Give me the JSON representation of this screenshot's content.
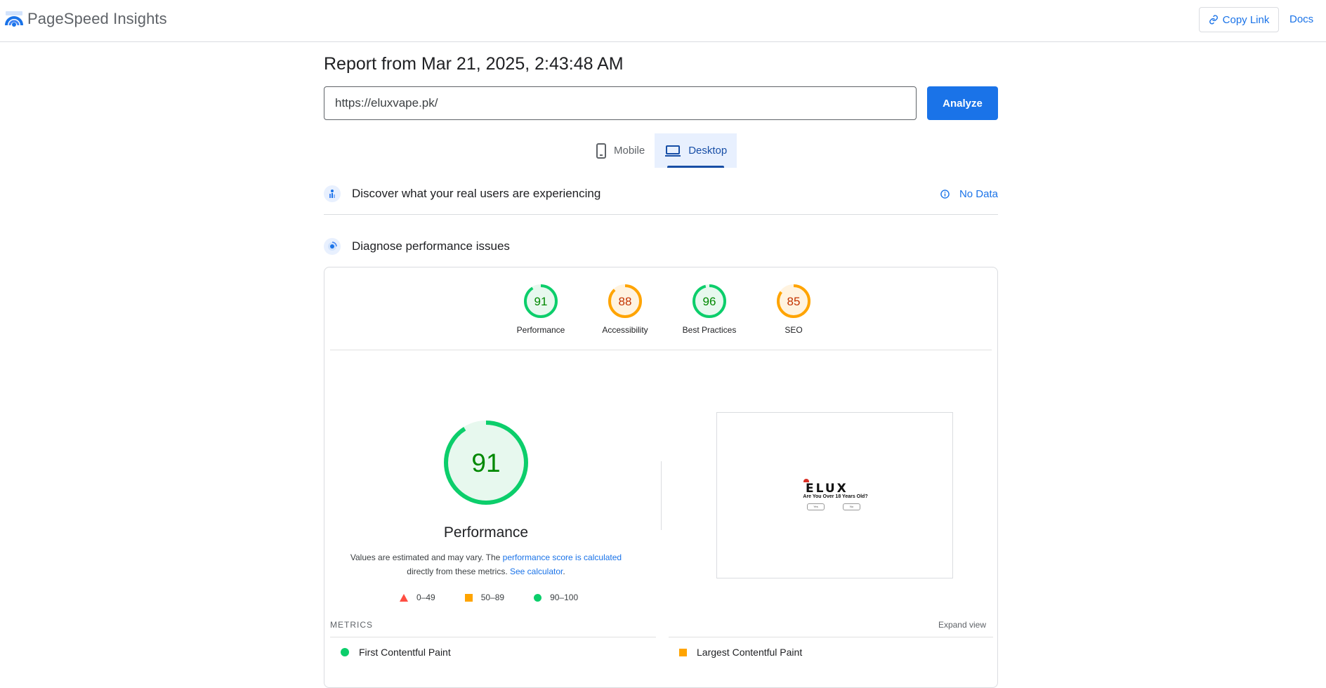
{
  "header": {
    "app_name": "PageSpeed Insights",
    "copy_link_label": "Copy Link",
    "docs_label": "Docs"
  },
  "report": {
    "title": "Report from Mar 21, 2025, 2:43:48 AM",
    "url_value": "https://eluxvape.pk/",
    "analyze_label": "Analyze"
  },
  "device_tabs": [
    {
      "label": "Mobile",
      "active": false
    },
    {
      "label": "Desktop",
      "active": true
    }
  ],
  "field_data": {
    "title": "Discover what your real users are experiencing",
    "status": "No Data"
  },
  "diagnose": {
    "title": "Diagnose performance issues"
  },
  "scores": [
    {
      "label": "Performance",
      "score": 91,
      "color": "#0cce6b",
      "text_color": "#008800",
      "bg": "#e7f8ee"
    },
    {
      "label": "Accessibility",
      "score": 88,
      "color": "#ffa400",
      "text_color": "#c33300",
      "bg": "#fff3e0"
    },
    {
      "label": "Best Practices",
      "score": 96,
      "color": "#0cce6b",
      "text_color": "#008800",
      "bg": "#e7f8ee"
    },
    {
      "label": "SEO",
      "score": 85,
      "color": "#ffa400",
      "text_color": "#c33300",
      "bg": "#fff3e0"
    }
  ],
  "performance": {
    "score": 91,
    "title": "Performance",
    "note_prefix": "Values are estimated and may vary. The ",
    "note_link1": "performance score is calculated",
    "note_middle": "directly from these metrics. ",
    "note_link2": "See calculator",
    "note_suffix": "."
  },
  "legend": [
    {
      "shape": "triangle",
      "color": "#ff4e42",
      "label": "0–49"
    },
    {
      "shape": "square",
      "color": "#ffa400",
      "label": "50–89"
    },
    {
      "shape": "circle",
      "color": "#0cce6b",
      "label": "90–100"
    }
  ],
  "screenshot": {
    "logo_text": "ELUX",
    "question": "Are You Over 18 Years Old?",
    "btn_yes": "Yes",
    "btn_no": "No"
  },
  "metrics": {
    "label": "METRICS",
    "expand_label": "Expand view",
    "items": [
      {
        "name": "First Contentful Paint",
        "status": "good"
      },
      {
        "name": "Largest Contentful Paint",
        "status": "average"
      }
    ]
  },
  "colors": {
    "accent": "#1a73e8",
    "good": "#0cce6b",
    "average": "#ffa400",
    "poor": "#ff4e42"
  }
}
